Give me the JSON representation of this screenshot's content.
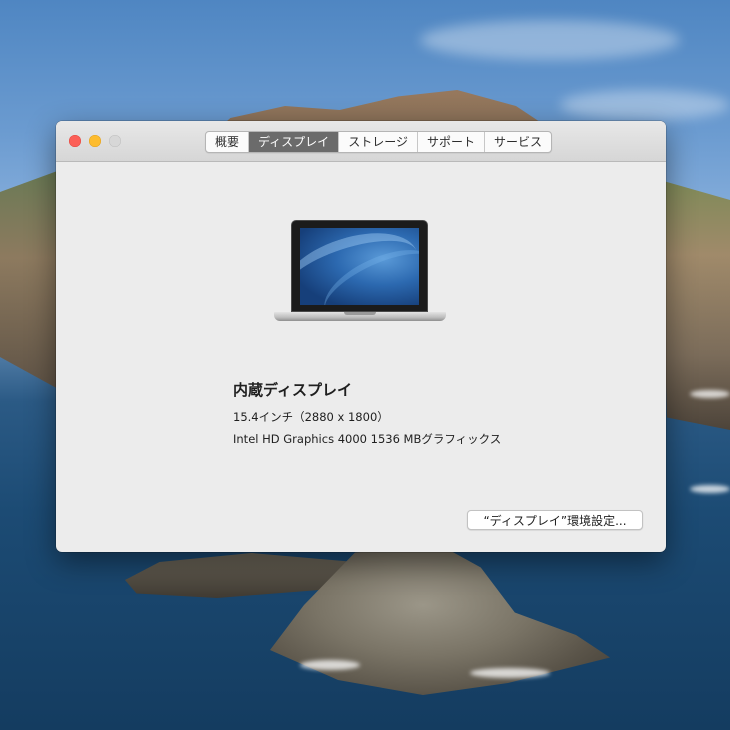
{
  "tabs": [
    {
      "label": "概要",
      "active": false
    },
    {
      "label": "ディスプレイ",
      "active": true
    },
    {
      "label": "ストレージ",
      "active": false
    },
    {
      "label": "サポート",
      "active": false
    },
    {
      "label": "サービス",
      "active": false
    }
  ],
  "display": {
    "name": "内蔵ディスプレイ",
    "size_resolution": "15.4インチ（2880 x 1800）",
    "graphics": "Intel HD Graphics 4000 1536 MBグラフィックス"
  },
  "prefs_button_label": "“ディスプレイ”環境設定...",
  "icons": {
    "close": "close-traffic-light-icon",
    "minimize": "minimize-traffic-light-icon",
    "zoom": "zoom-traffic-light-icon",
    "laptop": "macbook-laptop-icon"
  },
  "colors": {
    "close": "#fc5f57",
    "minimize": "#fdbc2e",
    "zoom_disabled": "#d7d7d7",
    "active_tab": "#6b6b6b",
    "window_bg": "#ececec"
  }
}
